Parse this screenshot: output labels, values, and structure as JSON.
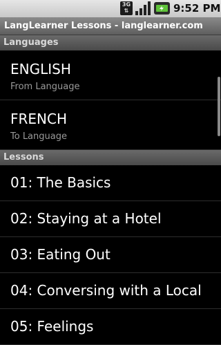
{
  "status_bar": {
    "network_label": "3G",
    "time": "9:52 PM",
    "icons": [
      "3g-data-icon",
      "signal-strength-icon",
      "battery-charging-icon"
    ]
  },
  "app": {
    "title": "LangLearner Lessons - langlearner.com"
  },
  "languages_section": {
    "header": "Languages",
    "items": [
      {
        "name": "ENGLISH",
        "subtitle": "From Language"
      },
      {
        "name": "FRENCH",
        "subtitle": "To Language"
      }
    ]
  },
  "lessons_section": {
    "header": "Lessons",
    "items": [
      "01: The Basics",
      "02: Staying at a Hotel",
      "03: Eating Out",
      "04: Conversing with a Local",
      "05: Feelings"
    ]
  },
  "colors": {
    "status_bar_bg": "#d4d4d4",
    "title_bar_bg": "#6e6e6e",
    "battery_green": "#5fc33a",
    "list_bg": "#000000"
  }
}
